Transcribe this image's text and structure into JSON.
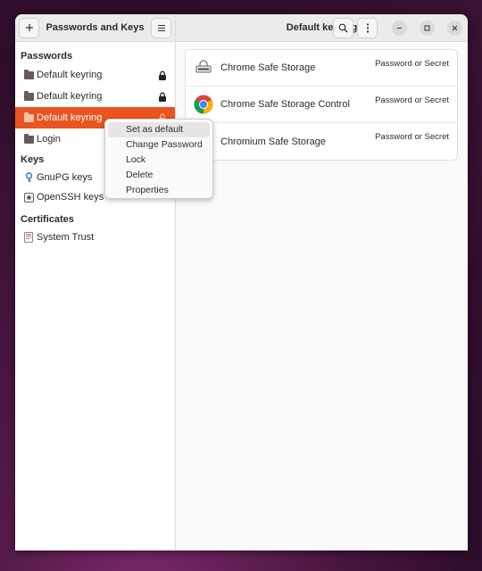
{
  "sidebar": {
    "title": "Passwords and Keys",
    "add_icon": "plus-icon",
    "menu_icon": "hamburger-icon",
    "sections": {
      "passwords": {
        "title": "Passwords",
        "items": [
          {
            "label": "Default keyring",
            "icon": "folder-icon",
            "locked": true
          },
          {
            "label": "Default keyring",
            "icon": "folder-icon",
            "locked": true
          },
          {
            "label": "Default keyring",
            "icon": "folder-icon",
            "locked": false
          },
          {
            "label": "Login",
            "icon": "folder-icon",
            "locked": false
          }
        ]
      },
      "keys": {
        "title": "Keys",
        "items": [
          {
            "label": "GnuPG keys",
            "icon": "gnupg-key-icon"
          },
          {
            "label": "OpenSSH keys",
            "icon": "ssh-key-icon"
          }
        ]
      },
      "certificates": {
        "title": "Certificates",
        "items": [
          {
            "label": "System Trust",
            "icon": "certificate-icon"
          }
        ]
      }
    }
  },
  "main": {
    "title": "Default keyring",
    "items": [
      {
        "name": "Chrome Safe Storage",
        "type": "Password or Secret",
        "icon": "keyring-password-icon"
      },
      {
        "name": "Chrome Safe Storage Control",
        "type": "Password or Secret",
        "icon": "chrome-icon"
      },
      {
        "name": "Chromium Safe Storage",
        "type": "Password or Secret",
        "icon": "chromium-icon"
      }
    ]
  },
  "context_menu": {
    "items": [
      "Set as default",
      "Change Password",
      "Lock",
      "Delete",
      "Properties"
    ],
    "hovered_index": 0
  },
  "colors": {
    "accent": "#e95420"
  }
}
